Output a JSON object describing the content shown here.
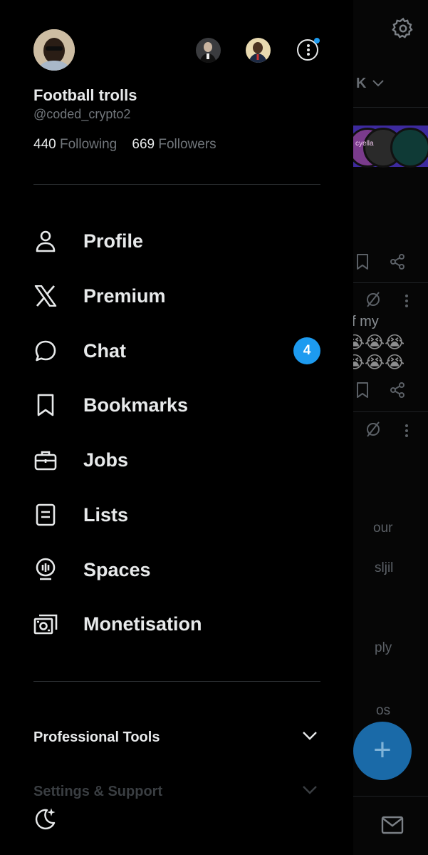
{
  "profile": {
    "name": "Football trolls",
    "handle": "@coded_crypto2",
    "following_count": "440",
    "following_label": "Following",
    "followers_count": "669",
    "followers_label": "Followers"
  },
  "nav": {
    "profile": "Profile",
    "premium": "Premium",
    "chat": "Chat",
    "chat_badge": "4",
    "bookmarks": "Bookmarks",
    "jobs": "Jobs",
    "lists": "Lists",
    "spaces": "Spaces",
    "monetisation": "Monetisation"
  },
  "sections": {
    "professional_tools": "Professional Tools",
    "settings_support": "Settings & Support"
  },
  "background": {
    "tab_fragment": "K",
    "banner_fragment": "cyella",
    "text_fragments": [
      "f my",
      "our",
      "sljil",
      "ply",
      "os"
    ],
    "emoji": "😭😭😭",
    "compose_symbol": "+"
  },
  "colors": {
    "accent": "#1d9bf0",
    "text_primary": "#e7e9ea",
    "text_secondary": "#71767b",
    "divider": "#2f3336"
  },
  "icons": [
    "settings-gear-icon",
    "chevron-down-icon",
    "bookmark-icon",
    "share-icon",
    "grok-icon",
    "more-vertical-icon",
    "person-icon",
    "x-logo-icon",
    "chat-bubble-icon",
    "briefcase-icon",
    "list-icon",
    "spaces-mic-icon",
    "money-icon",
    "moon-icon",
    "mail-icon",
    "plus-icon"
  ]
}
